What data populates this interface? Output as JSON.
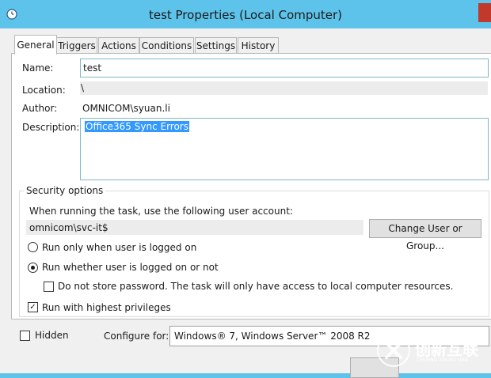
{
  "window": {
    "title": "test Properties (Local Computer)"
  },
  "tabs": [
    {
      "label": "General"
    },
    {
      "label": "Triggers"
    },
    {
      "label": "Actions"
    },
    {
      "label": "Conditions"
    },
    {
      "label": "Settings"
    },
    {
      "label": "History"
    }
  ],
  "general": {
    "name_label": "Name:",
    "name_value": "test",
    "location_label": "Location:",
    "location_value": "\\",
    "author_label": "Author:",
    "author_value": "OMNICOM\\syuan.li",
    "description_label": "Description:",
    "description_value": "Office365 Sync Errors"
  },
  "security": {
    "title": "Security options",
    "account_prompt": "When running the task, use the following user account:",
    "account_value": "omnicom\\svc-it$",
    "change_button": "Change User or Group...",
    "radio_logged_on": "Run only when user is logged on",
    "radio_whether": "Run whether user is logged on or not",
    "no_store_password": "Do not store password.  The task will only have access to local computer resources.",
    "highest_privileges": "Run with highest privileges",
    "highest_privileges_checked": true,
    "selected_radio": "whether"
  },
  "footer": {
    "hidden_label": "Hidden",
    "configure_label": "Configure for:",
    "configure_value": "Windows® 7, Windows Server™ 2008 R2"
  },
  "watermark": {
    "cn_text": "创新互联",
    "en_text": "CHUANG XIN HU LIAN"
  }
}
